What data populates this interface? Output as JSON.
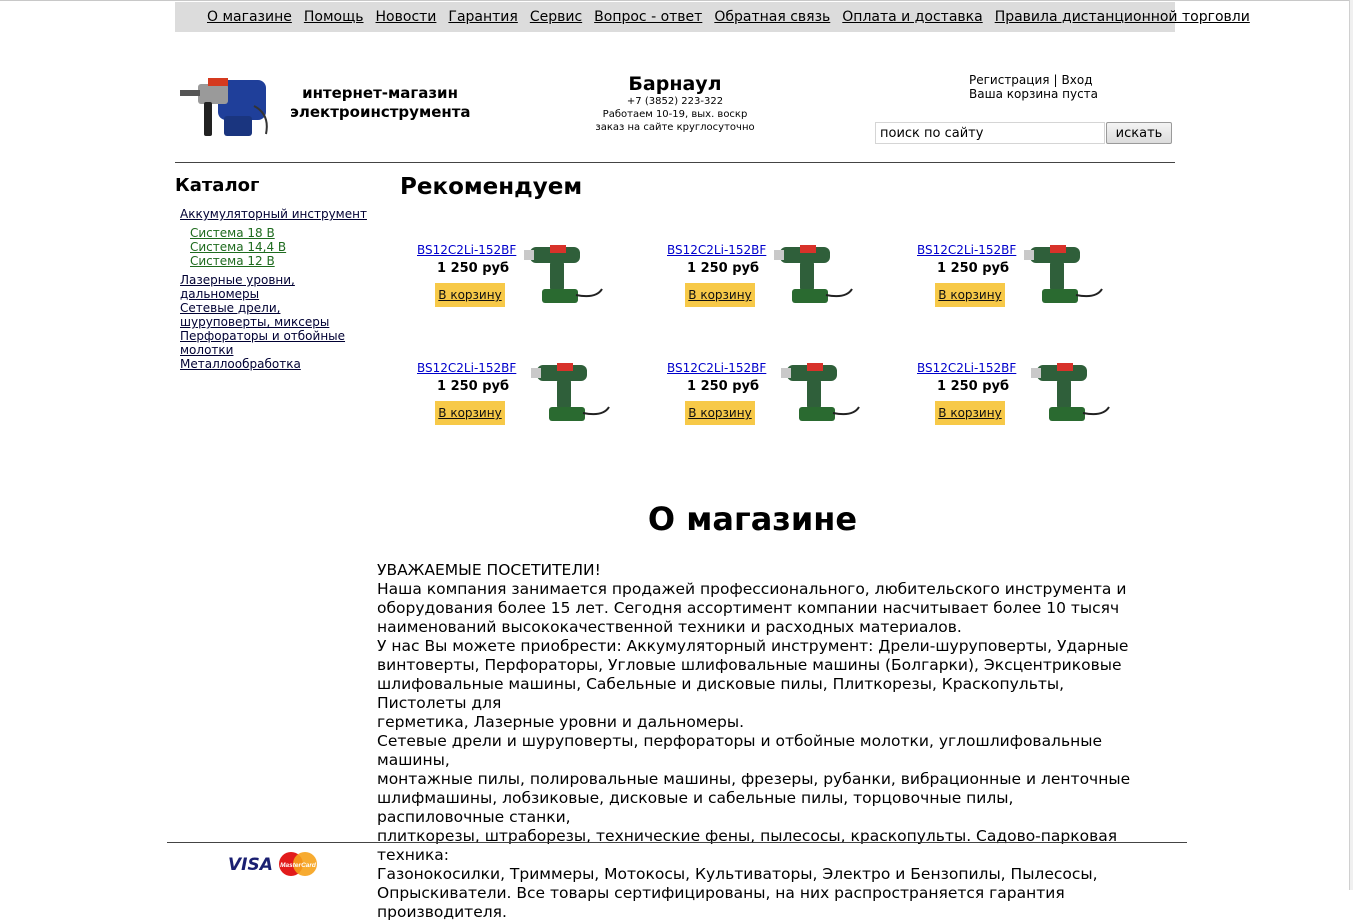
{
  "nav": [
    "О магазине",
    "Помощь",
    "Новости",
    "Гарантия",
    "Сервис",
    "Вопрос - ответ",
    "Обратная связь",
    "Оплата и доставка",
    "Правила дистанционной торговли"
  ],
  "header": {
    "tagline_line1": "интернет-магазин",
    "tagline_line2": "электроинструмента",
    "city": "Барнаул",
    "phone": "+7 (3852) 223-322",
    "hours": "Работаем 10-19, вых. воскр",
    "order_note": "заказ на сайте круглосуточно",
    "register": "Регистрация",
    "separator": "|",
    "login": "Вход",
    "cart_status": "Ваша корзина пуста",
    "search_value": "поиск по сайту",
    "search_button": "искать"
  },
  "catalog": {
    "title": "Каталог",
    "items": [
      {
        "label": "Аккумуляторный инструмент",
        "children": [
          "Система 18 В",
          "Система 14,4 В",
          "Система 12 В"
        ]
      },
      {
        "label": "Лазерные уровни, дальномеры",
        "children": []
      },
      {
        "label": "Сетевые дрели, шуруповерты, миксеры",
        "children": []
      },
      {
        "label": "Перфораторы и отбойные молотки",
        "children": []
      },
      {
        "label": "Металлообработка",
        "children": []
      }
    ]
  },
  "recommend": {
    "title": "Рекомендуем",
    "products": [
      {
        "name": "BS12C2Li-152BF",
        "price": "1 250 руб",
        "button": "В корзину"
      },
      {
        "name": "BS12C2Li-152BF",
        "price": "1 250 руб",
        "button": "В корзину"
      },
      {
        "name": "BS12C2Li-152BF",
        "price": "1 250 руб",
        "button": "В корзину"
      },
      {
        "name": "BS12C2Li-152BF",
        "price": "1 250 руб",
        "button": "В корзину"
      },
      {
        "name": "BS12C2Li-152BF",
        "price": "1 250 руб",
        "button": "В корзину"
      },
      {
        "name": "BS12C2Li-152BF",
        "price": "1 250 руб",
        "button": "В корзину"
      }
    ]
  },
  "about": {
    "title": "О магазине",
    "lines": [
      "УВАЖАЕМЫЕ ПОСЕТИТЕЛИ!",
      "Наша компания занимается продажей профессионального, любительского инструмента и",
      "оборудования более 15 лет. Сегодня ассортимент компании насчитывает более 10 тысяч",
      "наименований высококачественной техники и расходных материалов.",
      "У нас Вы можете приобрести: Аккумуляторный инструмент: Дрели-шуруповерты, Ударные",
      "винтоверты, Перфораторы, Угловые шлифовальные машины (Болгарки), Эксцентриковые",
      "шлифовальные машины, Сабельные и дисковые пилы, Плиткорезы, Краскопульты, Пистолеты для",
      "герметика, Лазерные уровни и дальномеры.",
      "Сетевые дрели и шуруповерты, перфораторы и отбойные молотки, углошлифовальные машины,",
      "монтажные пилы, полировальные машины, фрезеры, рубанки, вибрационные и ленточные",
      "шлифмашины, лобзиковые, дисковые и сабельные пилы, торцовочные пилы, распиловочные станки,",
      "плиткорезы, штраборезы, технические фены, пылесосы, краскопульты. Садово-парковая техника:",
      "Газонокосилки, Триммеры, Мотокосы, Культиваторы, Электро и Бензопилы, Пылесосы,",
      "Опрыскиватели. Все товары сертифицированы, на них распространяется гарантия производителя."
    ]
  },
  "footer": {
    "visa": "VISA",
    "mastercard": "MasterCard"
  },
  "colors": {
    "nav_bg": "#dcdcdc",
    "buy_button": "#f7c948",
    "link_blue": "#0000cc",
    "sub_link_green": "#1e6b1e"
  }
}
